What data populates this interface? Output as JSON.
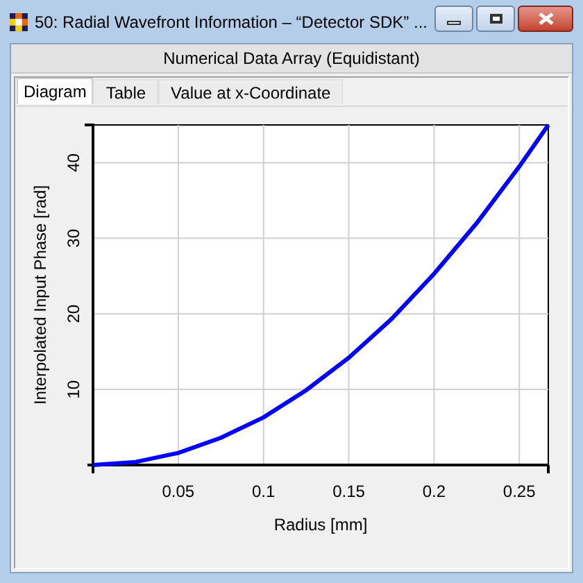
{
  "window": {
    "title": "50: Radial Wavefront Information – “Detector SDK” ..."
  },
  "header": "Numerical Data Array (Equidistant)",
  "tabs": [
    {
      "label": "Diagram",
      "selected": true
    },
    {
      "label": "Table",
      "selected": false
    },
    {
      "label": "Value at x-Coordinate",
      "selected": false
    }
  ],
  "chart_data": {
    "type": "line",
    "xlabel": "Radius [mm]",
    "ylabel": "Interpolated Input Phase [rad]",
    "x": [
      0,
      0.025,
      0.05,
      0.075,
      0.1,
      0.125,
      0.15,
      0.175,
      0.2,
      0.225,
      0.25,
      0.267
    ],
    "series": [
      {
        "color": "#0000ff",
        "values": [
          0,
          0.4,
          1.6,
          3.6,
          6.3,
          9.9,
          14.2,
          19.3,
          25.3,
          32,
          39.5,
          45
        ]
      }
    ],
    "grid": true,
    "xlim": [
      0,
      0.267
    ],
    "ylim": [
      0,
      45
    ],
    "xticks": [
      {
        "value": 0.05,
        "label": "0.05"
      },
      {
        "value": 0.1,
        "label": "0.1"
      },
      {
        "value": 0.15,
        "label": "0.15"
      },
      {
        "value": 0.2,
        "label": "0.2"
      },
      {
        "value": 0.25,
        "label": "0.25"
      }
    ],
    "yticks": [
      10,
      20,
      30,
      40
    ]
  }
}
